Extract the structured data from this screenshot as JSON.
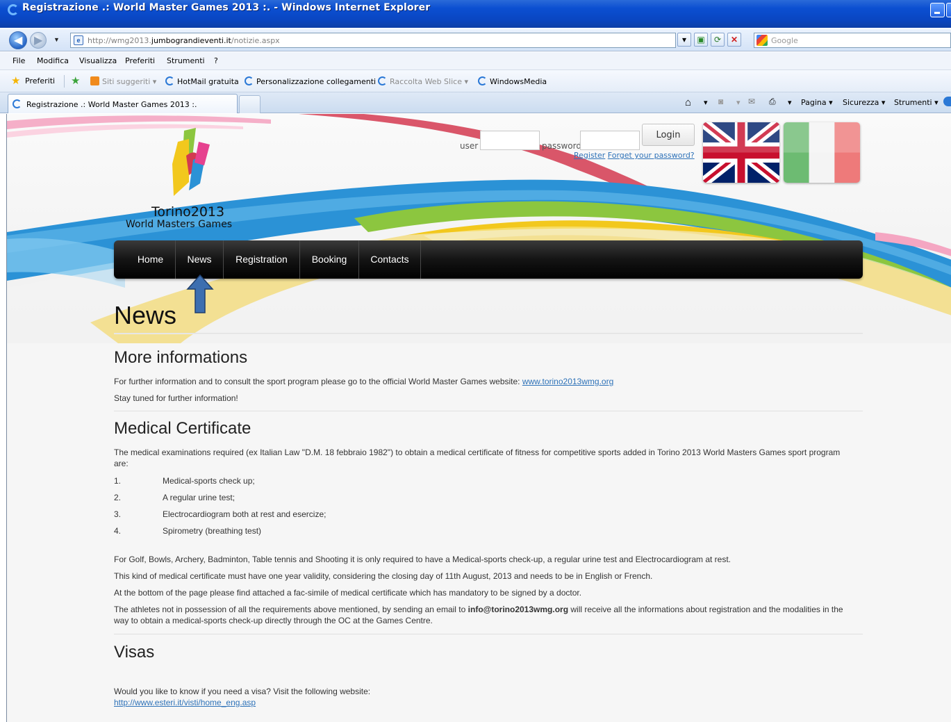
{
  "window": {
    "title": "Registrazione .: World Master Games 2013 :. - Windows Internet Explorer"
  },
  "address": {
    "url_prefix": "http://wmg2013.",
    "url_domain": "jumbograndieventi.it",
    "url_path": "/notizie.aspx",
    "search_placeholder": "Google"
  },
  "menu": [
    "File",
    "Modifica",
    "Visualizza",
    "Preferiti",
    "Strumenti",
    "?"
  ],
  "favorites": {
    "label": "Preferiti",
    "items": [
      "Siti suggeriti",
      "HotMail gratuita",
      "Personalizzazione collegamenti",
      "Raccolta Web Slice",
      "WindowsMedia"
    ]
  },
  "tab": {
    "title": "Registrazione .: World Master Games 2013 :."
  },
  "commands": [
    "Pagina",
    "Sicurezza",
    "Strumenti"
  ],
  "site": {
    "logo_line1": "Torino2013",
    "logo_line2": "World Masters Games",
    "login": {
      "user_label": "user",
      "password_label": "password",
      "button": "Login",
      "register": "Register",
      "forgot": "Forget your password?"
    },
    "nav": [
      "Home",
      "News",
      "Registration",
      "Booking",
      "Contacts"
    ],
    "page_title": "News",
    "sections": {
      "more_info": {
        "heading": "More informations",
        "p1": "For further information and to consult the sport program please go to the official World Master Games website: ",
        "p1_link": "www.torino2013wmg.org",
        "p2": "Stay tuned for further information!"
      },
      "medical": {
        "heading": "Medical Certificate",
        "intro": "The medical examinations required (ex Italian Law \"D.M. 18 febbraio 1982\") to obtain a medical certificate of fitness for competitive sports added in Torino 2013 World Masters Games sport program are:",
        "list": [
          {
            "num": "1.",
            "text": "Medical-sports check up;"
          },
          {
            "num": "2.",
            "text": "A regular urine test;"
          },
          {
            "num": "3.",
            "text": "Electrocardiogram both at rest and esercize;"
          },
          {
            "num": "4.",
            "text": "Spirometry (breathing test)"
          }
        ],
        "p_golf": "For Golf, Bowls, Archery, Badminton, Table tennis and Shooting it is only required to have a Medical-sports check-up, a regular urine test and Electrocardiogram at rest.",
        "p_validity": "This kind of medical certificate must have one year validity, considering the closing day of 11th August, 2013 and needs to be in English or French.",
        "p_bottom": "At the bottom of the page please find attached a fac-simile of medical certificate which has mandatory to be signed by a doctor.",
        "p_athletes_a": "The athletes not in possession of all the requirements above mentioned, by sending an email to ",
        "p_athletes_email": "info@torino2013wmg.org",
        "p_athletes_b": " will receive all the informations about registration and the modalities in the way to obtain a medical-sports check-up directly through the OC at the Games Centre."
      },
      "visas": {
        "heading": "Visas",
        "p1": "Would you like to know if you need a visa? Visit the following website:",
        "link": "http://www.esteri.it/visti/home_eng.asp"
      }
    }
  },
  "colors": {
    "link": "#2e72b8",
    "navbar": "#111111",
    "arrow": "#3d6fb0"
  }
}
